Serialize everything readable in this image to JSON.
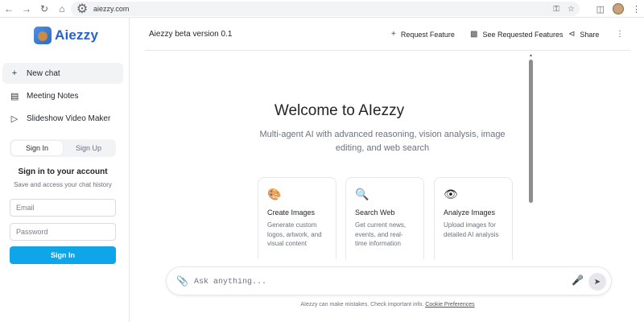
{
  "browser": {
    "url": "aiezzy.com",
    "back_icon": "arrow-left-icon",
    "forward_icon": "arrow-right-icon",
    "reload_icon": "reload-icon",
    "home_icon": "home-icon"
  },
  "sidebar": {
    "logo_text": "Aiezzy",
    "items": [
      {
        "label": "New chat",
        "icon": "plus-icon"
      },
      {
        "label": "Meeting Notes",
        "icon": "document-icon"
      },
      {
        "label": "Slideshow Video Maker",
        "icon": "video-icon"
      }
    ],
    "auth": {
      "tabs": [
        "Sign In",
        "Sign Up"
      ],
      "title": "Sign in to your account",
      "subtitle": "Save and access your chat history",
      "email_placeholder": "Email",
      "password_placeholder": "Password",
      "submit_label": "Sign In"
    }
  },
  "header": {
    "title": "Aiezzy beta version 0.1",
    "actions": [
      {
        "label": "Request Feature",
        "icon": "plus-icon"
      },
      {
        "label": "See Requested Features",
        "icon": "clipboard-icon"
      },
      {
        "label": "Share",
        "icon": "share-icon"
      }
    ]
  },
  "main": {
    "welcome": "Welcome to AIezzy",
    "description": "Multi-agent AI with advanced reasoning, vision analysis, image editing, and web search",
    "cards": [
      {
        "title": "Create Images",
        "desc": "Generate custom logos, artwork, and visual content",
        "icon": "palette-icon"
      },
      {
        "title": "Search Web",
        "desc": "Get current news, events, and real-time information",
        "icon": "magnifier-icon"
      },
      {
        "title": "Analyze Images",
        "desc": "Upload images for detailed AI analysis",
        "icon": "eye-icon"
      }
    ]
  },
  "composer": {
    "placeholder": "Ask anything..."
  },
  "footer": {
    "text": "AIezzy can make mistakes. Check important info.",
    "link": "Cookie Preferences"
  },
  "colors": {
    "accent": "#0ea5e9",
    "logo": "#2563c9"
  }
}
